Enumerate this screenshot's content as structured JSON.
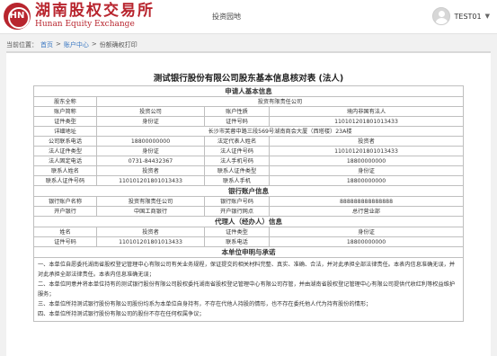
{
  "header": {
    "logo_cn": "湖南股权交易所",
    "logo_en": "Hunan Equity Exchange",
    "logo_glyph": "HN",
    "nav_link": "投资园地",
    "username": "TEST01",
    "caret": "▼"
  },
  "breadcrumb": {
    "prefix": "当前位置：",
    "home": "首页",
    "sep1": ">",
    "account": "账户中心",
    "sep2": ">",
    "current": "份额确权打印"
  },
  "document": {
    "title": "测试银行股份有限公司股东基本信息核对表 (法人)",
    "applicant_section": "申请人基本信息",
    "shareholder_name_label": "股东全称",
    "shareholder_name": "投资有限责任公司",
    "account_short_label": "账户简称",
    "account_short": "投资公司",
    "account_nature_label": "账户性质",
    "account_nature": "境内非国有法人",
    "id_type_label": "证件类型",
    "id_type": "身份证",
    "id_number_label": "证件号码",
    "id_number": "110101201801013433",
    "address_label": "详细地址",
    "address": "长沙市芙蓉中路三段569号湖南商会大厦（西塔楼）23A楼",
    "company_phone_label": "公司联系电话",
    "company_phone": "18800000000",
    "legal_rep_name_label": "法定代表人姓名",
    "legal_rep_name": "投资者",
    "legal_id_type_label": "法人证件类型",
    "legal_id_type": "身份证",
    "legal_id_number_label": "法人证件号码",
    "legal_id_number": "110101201801013433",
    "legal_fixed_phone_label": "法人固定电话",
    "legal_fixed_phone": "0731-84432367",
    "legal_mobile_label": "法人手机号码",
    "legal_mobile": "18800000000",
    "contact_name_label": "联系人姓名",
    "contact_name": "投资者",
    "contact_id_type_label": "联系人证件类型",
    "contact_id_type": "身份证",
    "contact_id_number_label": "联系人证件号码",
    "contact_id_number": "110101201801013433",
    "contact_mobile_label": "联系人手机",
    "contact_mobile": "18800000000",
    "bank_section": "银行账户信息",
    "bank_account_name_label": "银行账户名称",
    "bank_account_name": "投资有限责任公司",
    "bank_account_no_label": "银行账户号码",
    "bank_account_no": "888888888888888",
    "bank_label": "开户银行",
    "bank": "中国工商银行",
    "bank_branch_label": "开户银行网点",
    "bank_branch": "总行营业部",
    "agent_section": "代理人（经办人）信息",
    "agent_name_label": "姓名",
    "agent_name": "投资者",
    "agent_id_type_label": "证件类型",
    "agent_id_type": "身份证",
    "agent_id_number_label": "证件号码",
    "agent_id_number": "110101201801013433",
    "agent_mobile_label": "联系电话",
    "agent_mobile": "18800000000",
    "declaration_section": "本单位申明与承诺",
    "decl_1": "一、本单位自愿委托湖南省股权登记管理中心有限公司有关业务规程，保证提交的相关材料完整、真实、准确、合法，并对此承担全部法律责任。本表内信息准确无误，并对此承担全部法律责任。本表内信息准确无误；",
    "decl_2": "二、本单位同意并将本单位持有的测试银行股份有限公司股权委托湖南省股权登记管理中心有限公司存管，并由湖南省股权登记管理中心有限公司提供代收红利等权益维护服务；",
    "decl_3": "三、本单位所持测试银行股份有限公司股份均系为本单位自身持有，不存在代他人持股的情形，也不存在委托他人代为持有股份的情形；",
    "decl_4": "四、本单位所持测试银行股份有限公司的股份不存在任何权属争议；"
  }
}
